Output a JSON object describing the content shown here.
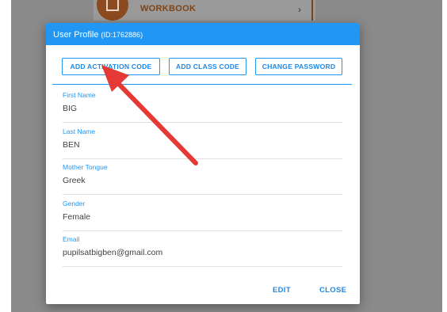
{
  "background": {
    "card_text": "WORKBOOK",
    "chevron": "›",
    "icon": "book-icon"
  },
  "dialog": {
    "title": "User Profile",
    "user_id": "(ID:1762886)",
    "buttons": {
      "add_activation_code": "ADD ACTIVATION CODE",
      "add_class_code": "ADD CLASS CODE",
      "change_password": "CHANGE PASSWORD"
    },
    "fields": [
      {
        "label": "First Name",
        "value": "BIG"
      },
      {
        "label": "Last Name",
        "value": "BEN"
      },
      {
        "label": "Mother Tongue",
        "value": "Greek"
      },
      {
        "label": "Gender",
        "value": "Female"
      },
      {
        "label": "Email",
        "value": "pupilsatbigben@gmail.com"
      }
    ],
    "actions": {
      "edit": "EDIT",
      "close": "CLOSE"
    }
  },
  "annotation": {
    "arrow_color": "#e53935",
    "points_to": "ADD ACTIVATION CODE"
  },
  "colors": {
    "primary": "#2196f3",
    "overlay": "#8a8a8a",
    "brand": "#8b4a1f"
  }
}
